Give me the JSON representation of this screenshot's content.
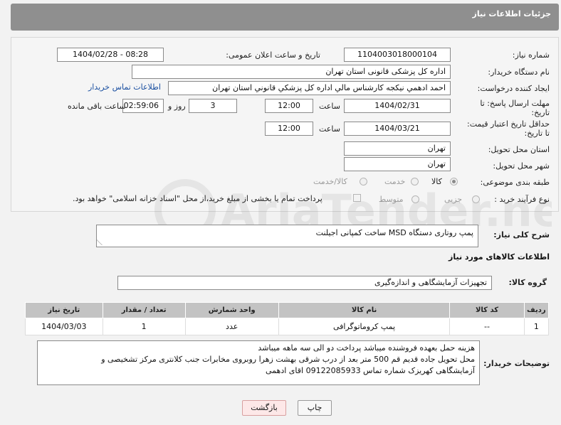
{
  "header": {
    "title": "جزئیات اطلاعات نیاز"
  },
  "form": {
    "need_number": {
      "label": "شماره نیاز:",
      "value": "1104003018000104"
    },
    "announce_datetime": {
      "label": "تاریخ و ساعت اعلان عمومی:",
      "value": "1404/02/28 - 08:28"
    },
    "buyer_org": {
      "label": "نام دستگاه خریدار:",
      "value": "اداره کل پزشکی قانونی استان تهران"
    },
    "requester": {
      "label": "ایجاد کننده درخواست:",
      "value": "احمد ادهمي نيكجه كارشناس مالي اداره كل پزشكي قانوني استان تهران",
      "contact_link": "اطلاعات تماس خریدار"
    },
    "reply_deadline": {
      "label_line1": "مهلت ارسال پاسخ: تا",
      "label_line2": "تاریخ:",
      "date": "1404/02/31",
      "time_label": "ساعت",
      "time": "12:00",
      "days": "3",
      "days_label": "روز و",
      "remaining": "02:59:06",
      "remaining_label": "ساعت باقی مانده"
    },
    "price_validity": {
      "label_line1": "حداقل تاریخ اعتبار قیمت:",
      "label_line2": "تا تاریخ:",
      "date": "1404/03/21",
      "time_label": "ساعت",
      "time": "12:00"
    },
    "delivery_province": {
      "label": "استان محل تحویل:",
      "value": "تهران"
    },
    "delivery_city": {
      "label": "شهر محل تحویل:",
      "value": "تهران"
    },
    "category": {
      "label": "طبقه بندی موضوعی:",
      "options": [
        "کالا",
        "خدمت",
        "کالا/خدمت"
      ],
      "selected": "کالا"
    },
    "purchase_type": {
      "label": "نوع فرآیند خرید :",
      "options": [
        "جزیی",
        "متوسط"
      ],
      "payment_note": "پرداخت تمام یا بخشی از مبلغ خرید،از محل \"اسناد خزانه اسلامی\" خواهد بود."
    }
  },
  "summary": {
    "label": "شرح کلی نیاز:",
    "value": "پمپ روتاری دستگاه MSD ساخت کمپانی اجیلنت"
  },
  "goods_info": {
    "title": "اطلاعات کالاهای مورد نیاز",
    "group_label": "گروه کالا:",
    "group_value": "تجهیزات آزمایشگاهی و اندازه‌گیری"
  },
  "table": {
    "headers": [
      "ردیف",
      "کد کالا",
      "نام کالا",
      "واحد شمارش",
      "تعداد / مقدار",
      "تاریخ نیاز"
    ],
    "rows": [
      [
        "1",
        "--",
        "پمپ کروماتوگرافی",
        "عدد",
        "1",
        "1404/03/03"
      ]
    ]
  },
  "buyer_notes": {
    "label": "توضیحات خریدار:",
    "lines": [
      "هزینه حمل بعهده فروشنده میباشد پرداخت دو الی سه ماهه میباشد",
      "محل تحویل جاده قدیم قم 500 متر بعد از درب شرقی بهشت زهرا روبروی مخابرات جنب کلانتری مرکز تشخیصی و",
      "آزمایشگاهی کهریزک شماره تماس 09122085933 اقای ادهمی"
    ]
  },
  "buttons": {
    "print": "چاپ",
    "back": "بازگشت"
  },
  "watermark": {
    "text": "AriaTender.neT"
  }
}
